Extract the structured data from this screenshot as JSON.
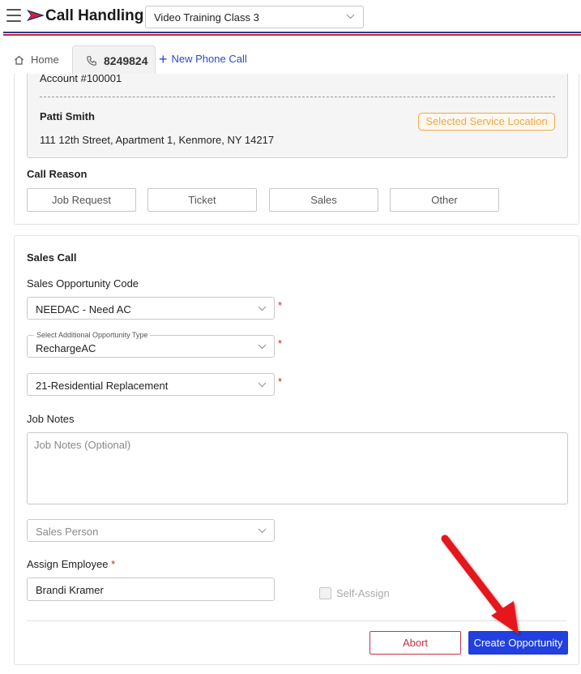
{
  "header": {
    "app_title": "Call Handling",
    "class_select_value": "Video Training Class 3"
  },
  "tabs": {
    "home_label": "Home",
    "phone_label": "8249824",
    "new_call_label": "New Phone Call"
  },
  "account": {
    "account_number": "Account #100001",
    "customer_name": "Patti Smith",
    "address": "111 12th Street, Apartment 1, Kenmore, NY 14217",
    "location_badge": "Selected Service Location"
  },
  "call_reason": {
    "title": "Call Reason",
    "options": [
      "Job Request",
      "Ticket",
      "Sales",
      "Other"
    ]
  },
  "sales_call": {
    "title": "Sales Call",
    "opportunity_code_label": "Sales Opportunity Code",
    "opportunity_code_value": "NEEDAC - Need AC",
    "additional_type_label": "Select Additional Opportunity Type",
    "additional_type_value": "RechargeAC",
    "category_value": "21-Residential Replacement",
    "required_mark": "*",
    "job_notes_label": "Job Notes",
    "job_notes_placeholder": "Job Notes (Optional)",
    "sales_person_placeholder": "Sales Person",
    "assign_employee_label": "Assign Employee",
    "assign_employee_value": "Brandi Kramer",
    "self_assign_label": "Self-Assign",
    "abort_label": "Abort",
    "create_label": "Create Opportunity"
  },
  "colors": {
    "primary_button": "#2240e0",
    "abort_red": "#c8324a",
    "badge_orange": "#f0a64a",
    "link_blue": "#2d48c9",
    "required_red": "#d42424",
    "annotation_arrow": "#e5141e"
  },
  "icons": {
    "menu": "hamburger-menu-icon",
    "logo": "flag-logo-icon",
    "home": "home-icon",
    "phone": "phone-icon",
    "add": "plus-icon",
    "dropdown": "chevron-down-icon"
  }
}
